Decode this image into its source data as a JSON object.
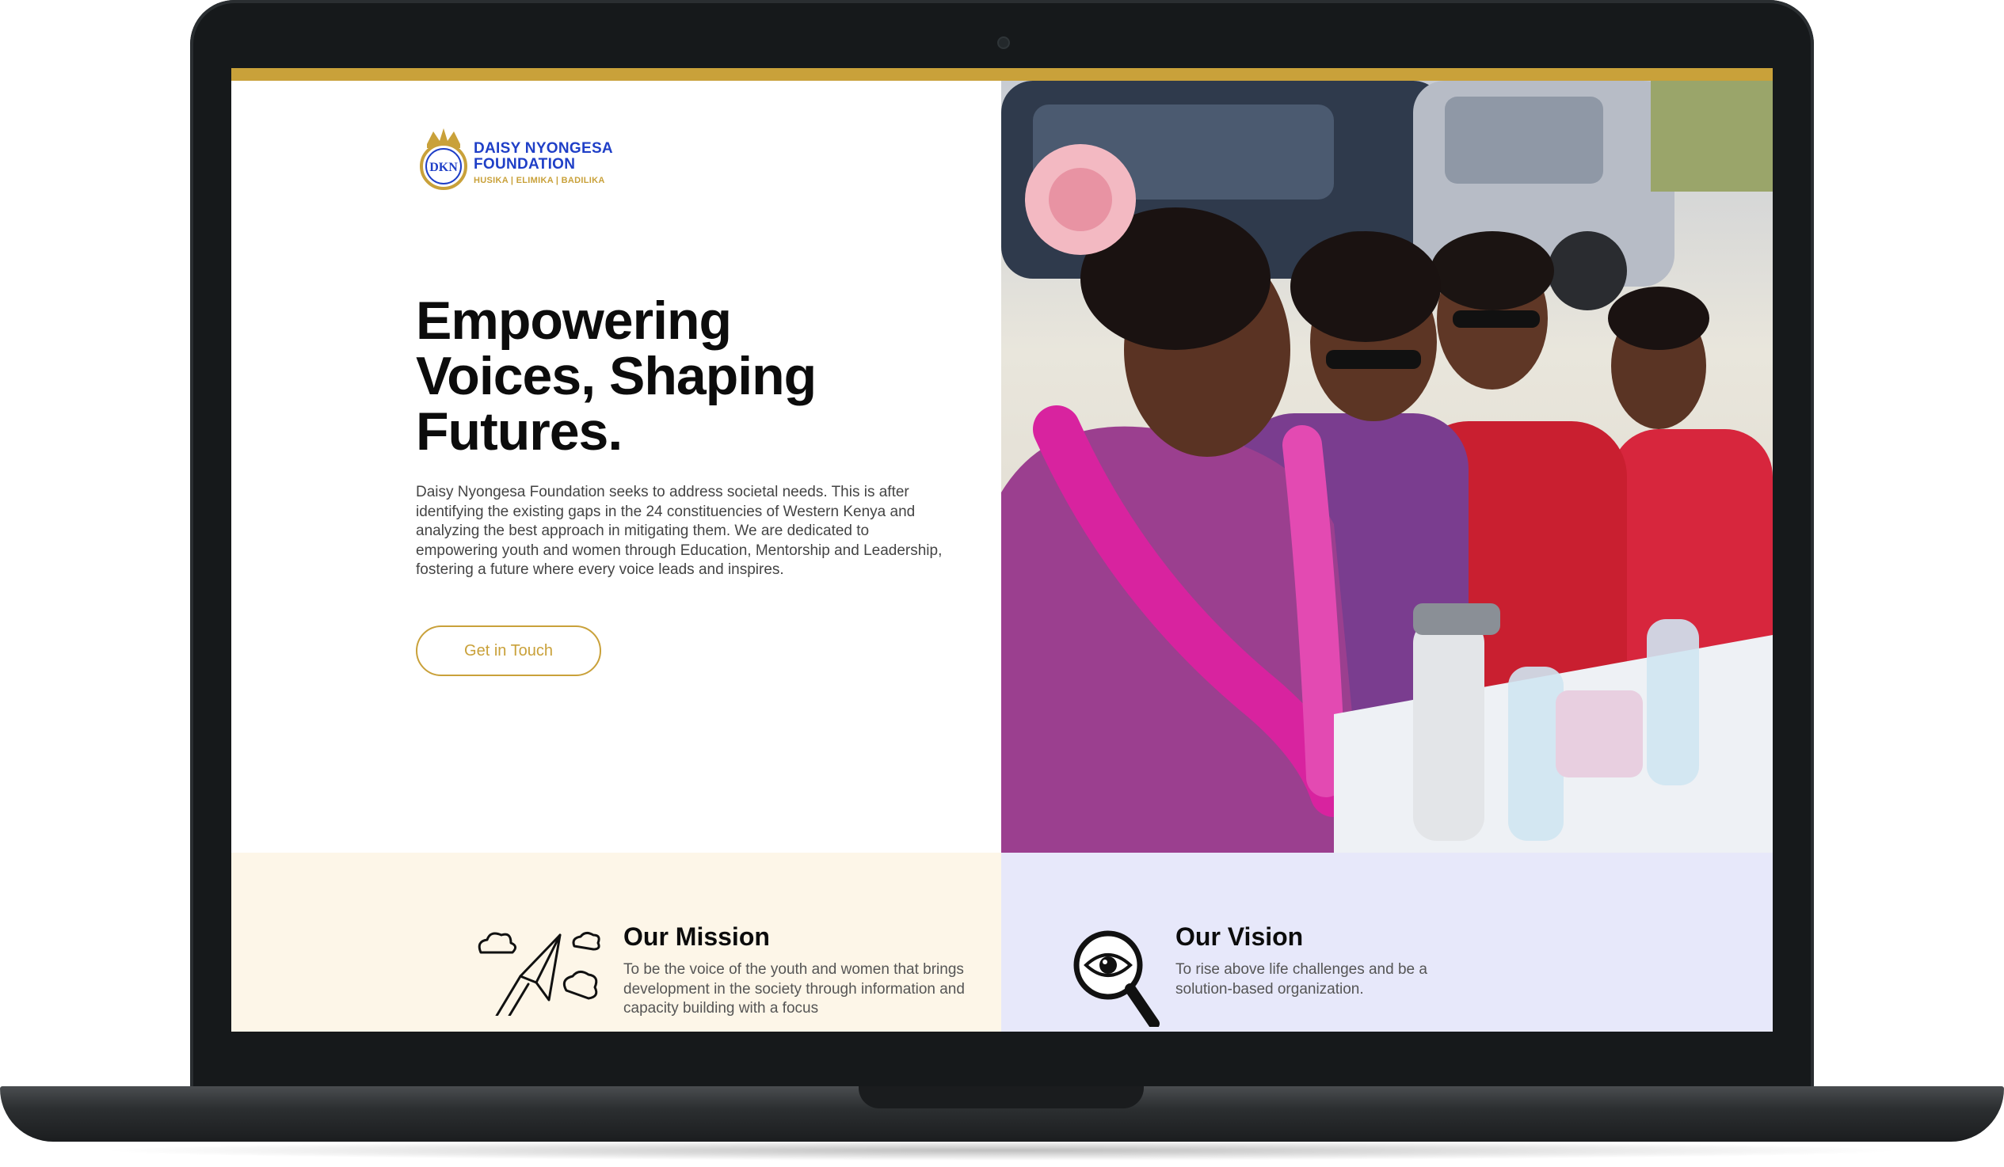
{
  "brand": {
    "name_line1": "DAISY NYONGESA",
    "name_line2": "FOUNDATION",
    "tagline": "HUSIKA | ELIMIKA | BADILIKA",
    "monogram": "DKN",
    "primary_color": "#1f3fc7",
    "accent_color": "#c9a13a"
  },
  "hero": {
    "headline_line1": "Empowering",
    "headline_line2": "Voices, Shaping",
    "headline_line3": "Futures.",
    "intro": "Daisy Nyongesa Foundation seeks to address societal needs. This is after identifying the existing gaps in the 24 constituencies of Western Kenya and analyzing the best approach in mitigating them. We are dedicated to empowering youth and women through Education, Mentorship and Leadership, fostering a future where every voice leads and inspires.",
    "cta_label": "Get in Touch",
    "photo_icon": "women-at-event-photo"
  },
  "mission": {
    "title": "Our Mission",
    "text": "To be the voice of the youth and women that brings development in the society through information and capacity building with a focus",
    "icon": "paper-plane-clouds-icon",
    "background": "#fdf6e8"
  },
  "vision": {
    "title": "Our Vision",
    "text": "To rise above life challenges and be a solution-based organization.",
    "icon": "eye-magnifier-icon",
    "background": "#e7e8fa"
  }
}
